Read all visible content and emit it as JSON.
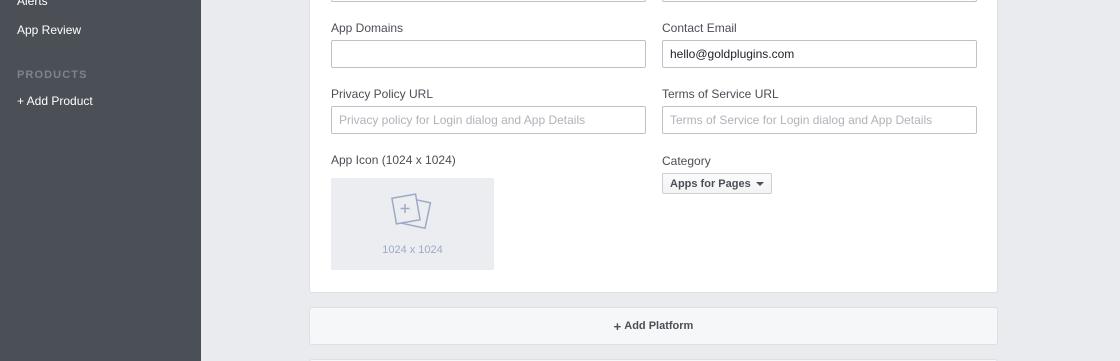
{
  "sidebar": {
    "items": [
      {
        "label": "Alerts"
      },
      {
        "label": "App Review"
      }
    ],
    "products_heading": "PRODUCTS",
    "add_product": "+ Add Product"
  },
  "form": {
    "app_domains": {
      "label": "App Domains",
      "value": "",
      "placeholder": ""
    },
    "contact_email": {
      "label": "Contact Email",
      "value": "hello@goldplugins.com"
    },
    "privacy_policy": {
      "label": "Privacy Policy URL",
      "value": "",
      "placeholder": "Privacy policy for Login dialog and App Details"
    },
    "terms_of_service": {
      "label": "Terms of Service URL",
      "value": "",
      "placeholder": "Terms of Service for Login dialog and App Details"
    },
    "app_icon": {
      "label": "App Icon (1024 x 1024)",
      "size_text": "1024 x 1024"
    },
    "category": {
      "label": "Category",
      "selected": "Apps for Pages"
    }
  },
  "add_platform": {
    "label": "Add Platform"
  },
  "colors": {
    "sidebar_bg": "#4b4f56",
    "page_bg": "#e9ebee",
    "card_bg": "#ffffff",
    "icon_placeholder": "#9daac7"
  },
  "icons": {
    "app_icon_placeholder": "image-plus-icon",
    "category_dropdown": "caret-down-icon",
    "add_platform": "plus-icon"
  }
}
